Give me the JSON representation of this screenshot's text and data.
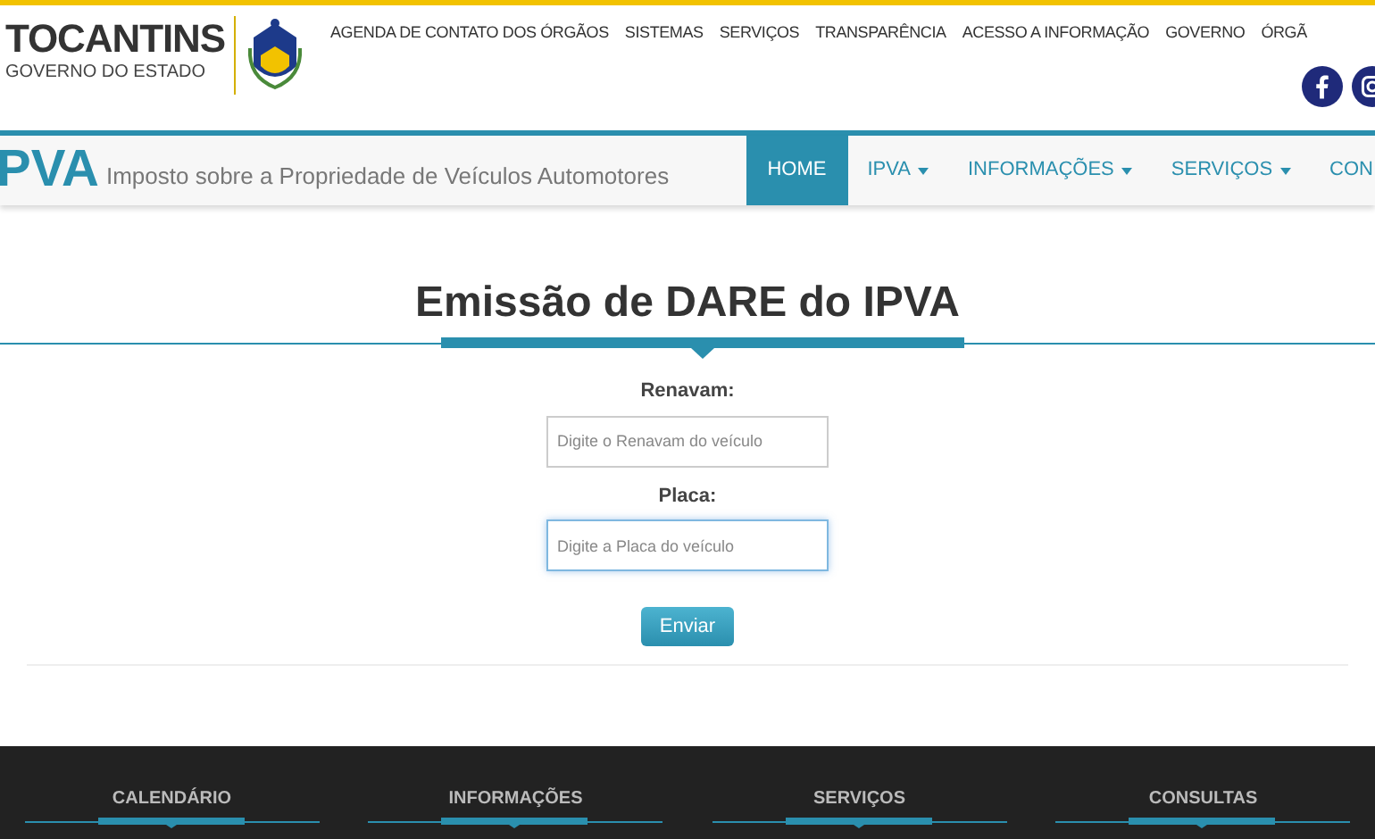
{
  "brand": {
    "name": "TOCANTINS",
    "subtitle": "GOVERNO DO ESTADO"
  },
  "top_menu": [
    "AGENDA DE CONTATO DOS ÓRGÃOS",
    "SISTEMAS",
    "SERVIÇOS",
    "TRANSPARÊNCIA",
    "ACESSO A INFORMAÇÃO",
    "GOVERNO",
    "ÓRGÃ"
  ],
  "site": {
    "logo": "PVA",
    "tagline": "Imposto sobre a Propriedade de Veículos Automotores"
  },
  "nav": [
    {
      "label": "HOME",
      "selected": true,
      "dropdown": false
    },
    {
      "label": "IPVA",
      "selected": false,
      "dropdown": true
    },
    {
      "label": "INFORMAÇÕES",
      "selected": false,
      "dropdown": true
    },
    {
      "label": "SERVIÇOS",
      "selected": false,
      "dropdown": true
    },
    {
      "label": "CON",
      "selected": false,
      "dropdown": false
    }
  ],
  "form": {
    "title": "Emissão de DARE do IPVA",
    "fields": [
      {
        "label": "Renavam:",
        "placeholder": "Digite o Renavam do veículo",
        "focused": false
      },
      {
        "label": "Placa:",
        "placeholder": "Digite a Placa do veículo",
        "focused": true
      }
    ],
    "submit": "Enviar"
  },
  "footer": [
    "CALENDÁRIO",
    "INFORMAÇÕES",
    "SERVIÇOS",
    "CONSULTAS"
  ]
}
